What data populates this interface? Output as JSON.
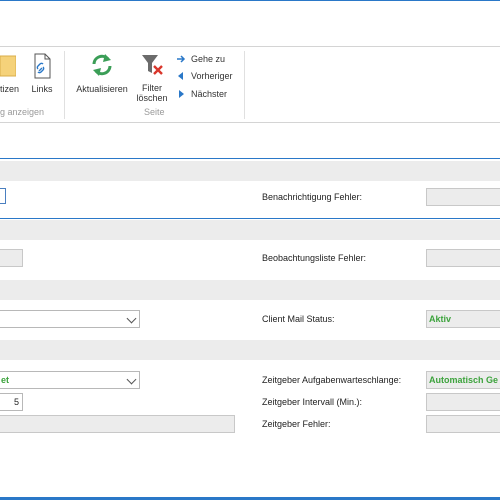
{
  "ribbon": {
    "notizen_label": "tizen",
    "links_label": "Links",
    "group1_label": "g anzeigen",
    "aktualisieren_label": "Aktualisieren",
    "filter_label_line1": "Filter",
    "filter_label_line2": "löschen",
    "gehe_zu_label": "Gehe zu",
    "vorheriger_label": "Vorheriger",
    "naechster_label": "Nächster",
    "group2_label": "Seite"
  },
  "form": {
    "benachrichtigung_fehler_label": "Benachrichtigung Fehler:",
    "beobachtungsliste_fehler_label": "Beobachtungsliste Fehler:",
    "client_mail_status_label": "Client Mail Status:",
    "client_mail_status_value": "Aktiv",
    "zeitgeber_aufgaben_label": "Zeitgeber Aufgabenwarteschlange:",
    "zeitgeber_aufgaben_value": "Automatisch Ge",
    "zeitgeber_intervall_label": "Zeitgeber Intervall (Min.):",
    "zeitgeber_fehler_label": "Zeitgeber Fehler:",
    "left_dropdown_value": "et",
    "interval_value": "5"
  },
  "colors": {
    "accent": "#2a78c8",
    "status_green": "#3da33d"
  }
}
